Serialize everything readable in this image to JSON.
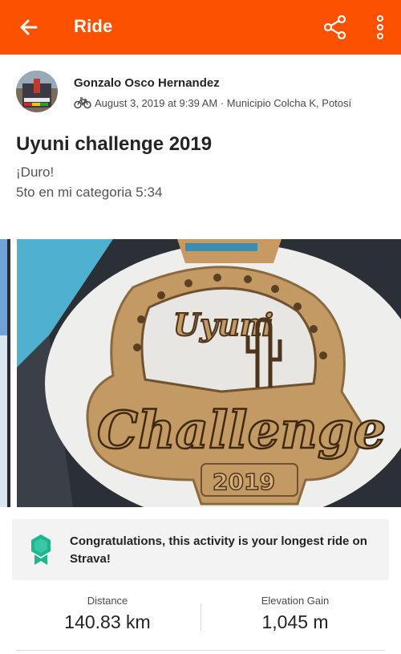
{
  "app_bar": {
    "title": "Ride",
    "background_color": "#fc5200",
    "back_icon": "arrow-left-icon",
    "share_icon": "share-icon",
    "more_icon": "more-vertical-icon"
  },
  "athlete": {
    "name": "Gonzalo Osco Hernandez",
    "activity_type_icon": "bicycle-icon",
    "meta": "August 3, 2019 at 9:39 AM · Municipio Colcha K, Potosí"
  },
  "activity": {
    "title": "Uyuni challenge 2019",
    "description_lines": [
      "¡Duro!",
      "5to en mi categoria 5:34"
    ]
  },
  "photo": {
    "medal_text_top": "Uyuni",
    "medal_text_main": "Challenge",
    "medal_year": "2019"
  },
  "achievement": {
    "icon": "achievement-badge-icon",
    "badge_color": "#1fb58f",
    "text": "Congratulations, this activity is your longest ride on Strava!"
  },
  "stats": [
    {
      "label": "Distance",
      "value": "140.83 km"
    },
    {
      "label": "Elevation Gain",
      "value": "1,045 m"
    }
  ]
}
